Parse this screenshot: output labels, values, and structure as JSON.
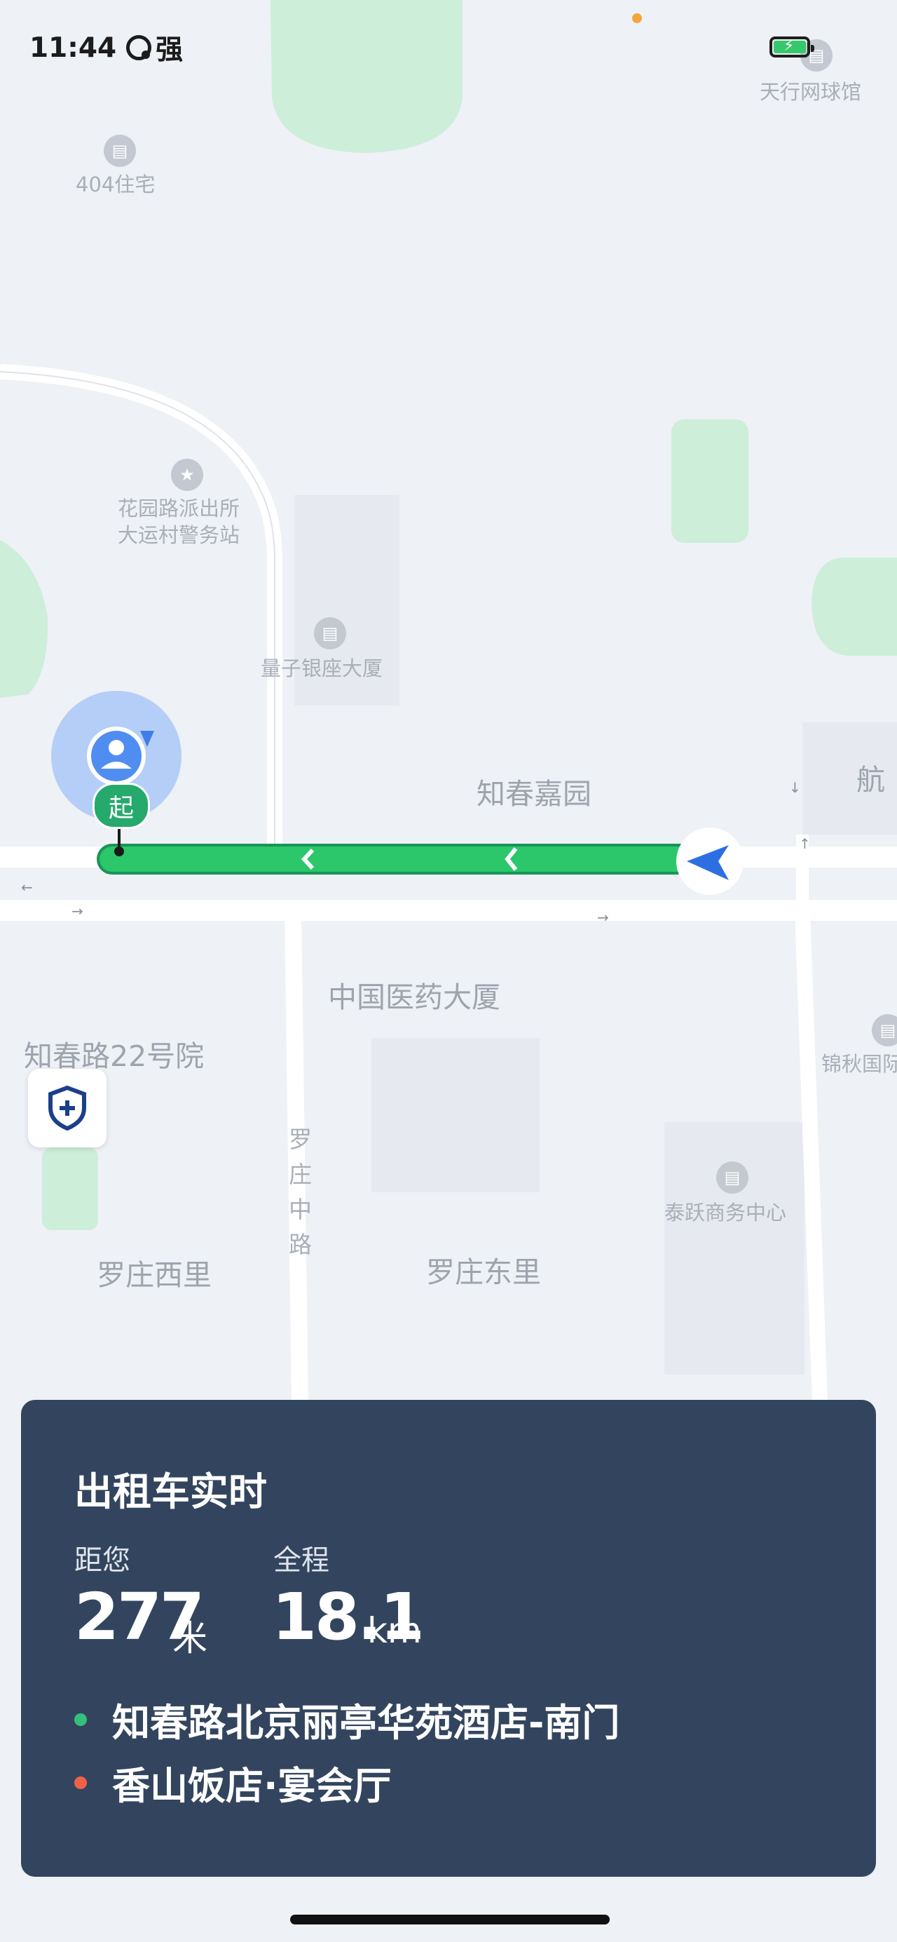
{
  "status_bar": {
    "time": "11:44",
    "carrier": "强"
  },
  "map": {
    "pois": {
      "tennis": "天行网球馆",
      "residence": "404住宅",
      "police_line1": "花园路派出所",
      "police_line2": "大运村警务站",
      "building": "量子银座大厦",
      "zhichun_garden": "知春嘉园",
      "hang": "航",
      "pharma": "中国医药大厦",
      "courtyard": "知春路22号院",
      "jinqiu": "锦秋国际",
      "luozhuang_mid_road": "罗庄中路",
      "taiyue": "泰跃商务中心",
      "luozhuang_west": "罗庄西里",
      "luozhuang_east": "罗庄东里"
    },
    "start_marker": "起",
    "route_color": "#2bc76a"
  },
  "trip_card": {
    "title": "出租车实时",
    "distance_to_you_label": "距您",
    "distance_to_you_value": "277",
    "distance_to_you_unit": "米",
    "total_label": "全程",
    "total_value": "18.1",
    "total_unit": "km",
    "origin": "知春路北京丽亭华苑酒店-南门",
    "destination": "香山饭店·宴会厅",
    "origin_dot_color": "#34c07a",
    "destination_dot_color": "#f06247"
  }
}
